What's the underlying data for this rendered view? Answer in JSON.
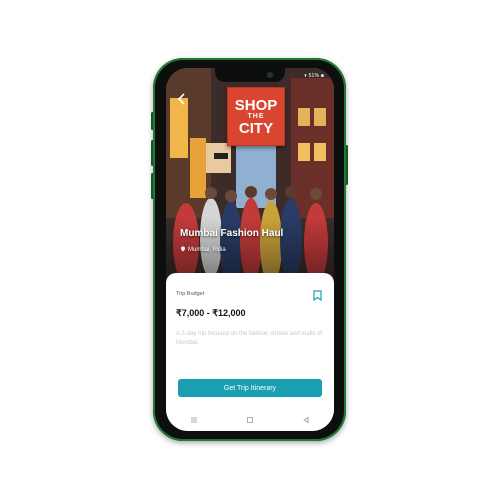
{
  "status": {
    "right": "▾ 51% ■"
  },
  "hero": {
    "sign_line1": "SHOP",
    "sign_line2": "THE",
    "sign_line3": "CITY",
    "title": "Mumbai Fashion Haul",
    "location": "Mumbai, India",
    "location_icon": "pin-icon"
  },
  "card": {
    "budget_label": "Trip Budget",
    "price": "₹7,000 - ₹12,000",
    "description": "A 2-day trip focused on the fashion streets and malls of Mumbai.",
    "cta_label": "Get Trip Itinerary"
  },
  "colors": {
    "accent": "#1a9fb2",
    "sign": "#d9452e",
    "phone_border": "#1f7a34"
  },
  "icons": {
    "back": "back-arrow-icon",
    "bookmark": "bookmark-icon",
    "nav_menu": "menu-icon",
    "nav_home": "home-square-icon",
    "nav_back": "back-triangle-icon"
  }
}
